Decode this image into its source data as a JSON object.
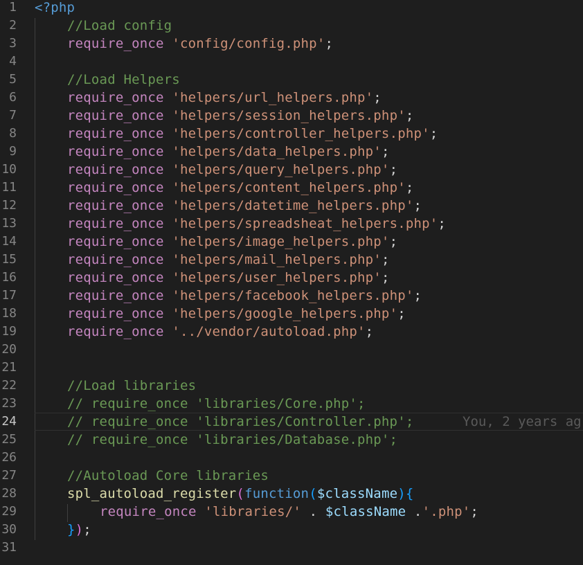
{
  "editor": {
    "line_numbers": [
      "1",
      "2",
      "3",
      "4",
      "5",
      "6",
      "7",
      "8",
      "9",
      "10",
      "11",
      "12",
      "13",
      "14",
      "15",
      "16",
      "17",
      "18",
      "19",
      "20",
      "21",
      "22",
      "23",
      "24",
      "25",
      "26",
      "27",
      "28",
      "29",
      "30",
      "31"
    ],
    "active_line": "24",
    "blame": "You, 2 years ag",
    "lines": [
      {
        "php_open": "<?php"
      },
      {
        "comment": "//Load config"
      },
      {
        "keyword": "require_once",
        "string": "'config/config.php'",
        "end": ";"
      },
      {},
      {
        "comment": "//Load Helpers"
      },
      {
        "keyword": "require_once",
        "string": "'helpers/url_helpers.php'",
        "end": ";"
      },
      {
        "keyword": "require_once",
        "string": "'helpers/session_helpers.php'",
        "end": ";"
      },
      {
        "keyword": "require_once",
        "string": "'helpers/controller_helpers.php'",
        "end": ";"
      },
      {
        "keyword": "require_once",
        "string": "'helpers/data_helpers.php'",
        "end": ";"
      },
      {
        "keyword": "require_once",
        "string": "'helpers/query_helpers.php'",
        "end": ";"
      },
      {
        "keyword": "require_once",
        "string": "'helpers/content_helpers.php'",
        "end": ";"
      },
      {
        "keyword": "require_once",
        "string": "'helpers/datetime_helpers.php'",
        "end": ";"
      },
      {
        "keyword": "require_once",
        "string": "'helpers/spreadsheat_helpers.php'",
        "end": ";"
      },
      {
        "keyword": "require_once",
        "string": "'helpers/image_helpers.php'",
        "end": ";"
      },
      {
        "keyword": "require_once",
        "string": "'helpers/mail_helpers.php'",
        "end": ";"
      },
      {
        "keyword": "require_once",
        "string": "'helpers/user_helpers.php'",
        "end": ";"
      },
      {
        "keyword": "require_once",
        "string": "'helpers/facebook_helpers.php'",
        "end": ";"
      },
      {
        "keyword": "require_once",
        "string": "'helpers/google_helpers.php'",
        "end": ";"
      },
      {
        "keyword": "require_once",
        "string": "'../vendor/autoload.php'",
        "end": ";"
      },
      {},
      {},
      {
        "comment": "//Load libraries"
      },
      {
        "comment": "// require_once 'libraries/Core.php';"
      },
      {
        "comment": "// require_once 'libraries/Controller.php';"
      },
      {
        "comment": "// require_once 'libraries/Database.php';"
      },
      {},
      {
        "comment": "//Autoload Core libraries"
      },
      {
        "fn": "spl_autoload_register",
        "paren_open": "(",
        "function_kw": "function",
        "arg_open": "(",
        "param": "$className",
        "arg_close": ")",
        "brace_open": "{"
      },
      {
        "keyword": "require_once",
        "string": "'libraries/'",
        "dot1": " . ",
        "var": "$className",
        "dot2": " .",
        "string2": "'.php'",
        "end": ";"
      },
      {
        "brace_close": "}",
        "paren_close": ")",
        "end": ";"
      },
      {}
    ]
  },
  "colors": {
    "background": "#1e1e1e",
    "keyword": "#c586c0",
    "string": "#ce9178",
    "comment": "#6a9955",
    "function": "#dcdcaa",
    "variable": "#9cdcfe",
    "php_tag": "#569cd6",
    "line_number": "#858585"
  }
}
